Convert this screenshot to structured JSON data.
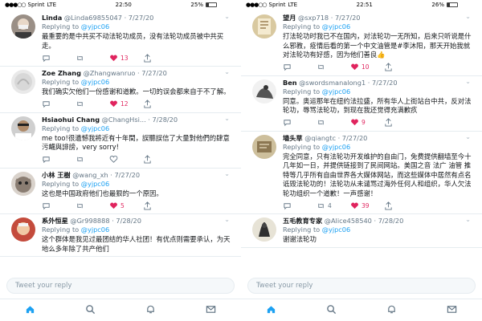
{
  "left_phone": {
    "status": {
      "carrier": "Sprint",
      "network": "LTE",
      "time": "22:50",
      "battery": "25%"
    },
    "tweets": [
      {
        "name": "Linda",
        "handle": "@Linda69855047",
        "date": "7/27/20",
        "reply_prefix": "Replying to",
        "reply_to": "@yjpc06",
        "text": "最重要的是中共买不动法轮功成员，没有法轮功成员被中共买走。",
        "replies": "",
        "retweets": "",
        "likes": "13",
        "liked": true
      },
      {
        "name": "Zoe Zhang",
        "handle": "@Zhangwanruo",
        "date": "7/27/20",
        "reply_prefix": "Replying to",
        "reply_to": "@yjpc06",
        "text": "我们确实欠他们一份感谢和道歉。一切的误会都来自于不了解。",
        "replies": "",
        "retweets": "",
        "likes": "12",
        "liked": true
      },
      {
        "name": "Hsiaohui Chang",
        "handle": "@ChangHsi...",
        "date": "7/28/20",
        "reply_prefix": "Replying to",
        "reply_to": "@yjpc06",
        "text": "me too!很遺憾我將近有十年間，誤聽誤信了大量對他們的肆意污衊與誹謗，very sorry!",
        "replies": "",
        "retweets": "",
        "likes": "",
        "liked": false
      },
      {
        "name": "小林 王樹",
        "handle": "@wang_xh",
        "date": "7/27/20",
        "reply_prefix": "Replying to",
        "reply_to": "@yjpc06",
        "text": "这也是中国政府他们也最狠的一个原因。",
        "replies": "",
        "retweets": "",
        "likes": "5",
        "liked": true
      },
      {
        "name": "系外恒星",
        "handle": "@Gr998888",
        "date": "7/28/20",
        "reply_prefix": "Replying to",
        "reply_to": "@yjpc06",
        "text": "这个群体是我见过最团结的华人社团！有优点则需要承认，为天地么多年除了共产他们",
        "replies": "",
        "retweets": "",
        "likes": "",
        "liked": false
      }
    ],
    "composer_placeholder": "Tweet your reply"
  },
  "right_phone": {
    "status": {
      "carrier": "Sprint",
      "network": "LTE",
      "time": "22:51",
      "battery": "26%"
    },
    "tweets": [
      {
        "name": "望月",
        "handle": "@sxp718",
        "date": "7/27/20",
        "reply_prefix": "Replying to",
        "reply_to": "@yjpc06",
        "text": "打法轮功时我已不在国内，对法轮功一无所知，后来只听说是什么邪教，疫情后看的第一个中文油管是#李沐阳，那天开始我就对法轮功有好感，因为他们善良👍",
        "replies": "",
        "retweets": "",
        "likes": "10",
        "liked": true
      },
      {
        "name": "Ben",
        "handle": "@swordsmanalong1",
        "date": "7/27/20",
        "reply_prefix": "Replying to",
        "reply_to": "@yjpc06",
        "text": "同意。奥运那年在纽约法拉盛，所有华人上街站台中共，反对法轮功，辱骂法轮功，到现在我还觉得充满歉疚",
        "replies": "",
        "retweets": "",
        "likes": "9",
        "liked": true
      },
      {
        "name": "墙头草",
        "handle": "@qiangtc",
        "date": "7/27/20",
        "reply_prefix": "Replying to",
        "reply_to": "@yjpc06",
        "text": "完全同意，只有法轮功开发维护的自由门，免费提供翻墙至今十几年如一日，并提供链接到了民间网站。美国之音 法广 油管 推特等几乎所有自由世界各大媒体网站，而这些媒体中居然有点名诋毁法轮功的！法轮功从未谴骂过海外任何人和组织，华人欠法轮功组织一个道歉！一声感谢！",
        "replies": "",
        "retweets": "4",
        "likes": "39",
        "liked": true
      },
      {
        "name": "五毛教育专家",
        "handle": "@Alice458540",
        "date": "7/28/20",
        "reply_prefix": "Replying to",
        "reply_to": "@yjpc06",
        "text": "谢谢法轮功",
        "replies": "",
        "retweets": "",
        "likes": "",
        "liked": false
      }
    ],
    "composer_placeholder": "Tweet your reply"
  },
  "tabs": [
    "home-icon",
    "search-icon",
    "notifications-icon",
    "messages-icon"
  ],
  "colors": {
    "accent": "#1da1f2",
    "like": "#e0245e",
    "muted": "#657786",
    "border": "#e6ecf0"
  }
}
